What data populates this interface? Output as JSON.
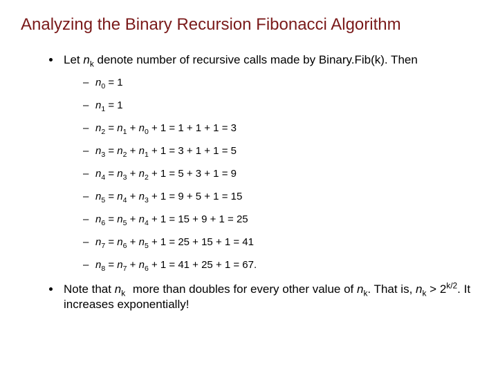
{
  "title": "Analyzing the Binary Recursion Fibonacci Algorithm",
  "intro_a": "Let ",
  "intro_b": " denote number of recursive calls made by Binary.Fib(k). Then",
  "eq": {
    "e0": " = 1",
    "e1": " = 1",
    "e2_mid": " + 1 = 1 + 1 + 1 = 3",
    "e3_mid": " + 1 = 3 + 1 + 1 = 5",
    "e4_mid": " + 1 = 5 + 3 + 1 = 9",
    "e5_mid": " + 1 = 9 + 5 + 1 = 15",
    "e6_mid": " + 1 = 15 + 9 + 1 = 25",
    "e7_mid": " + 1 = 25 + 15 + 1 = 41",
    "e8_mid": " + 1 = 41 + 25 + 1 = 67."
  },
  "note_a": "Note that ",
  "note_b": " more than doubles for every other value of ",
  "note_c": ". That is, ",
  "note_d": " > 2",
  "note_e": ". It increases exponentially!",
  "sym": {
    "n": "n",
    "eq": " = ",
    "plus": " + ",
    "kover2": "k/2",
    "k": "k"
  }
}
